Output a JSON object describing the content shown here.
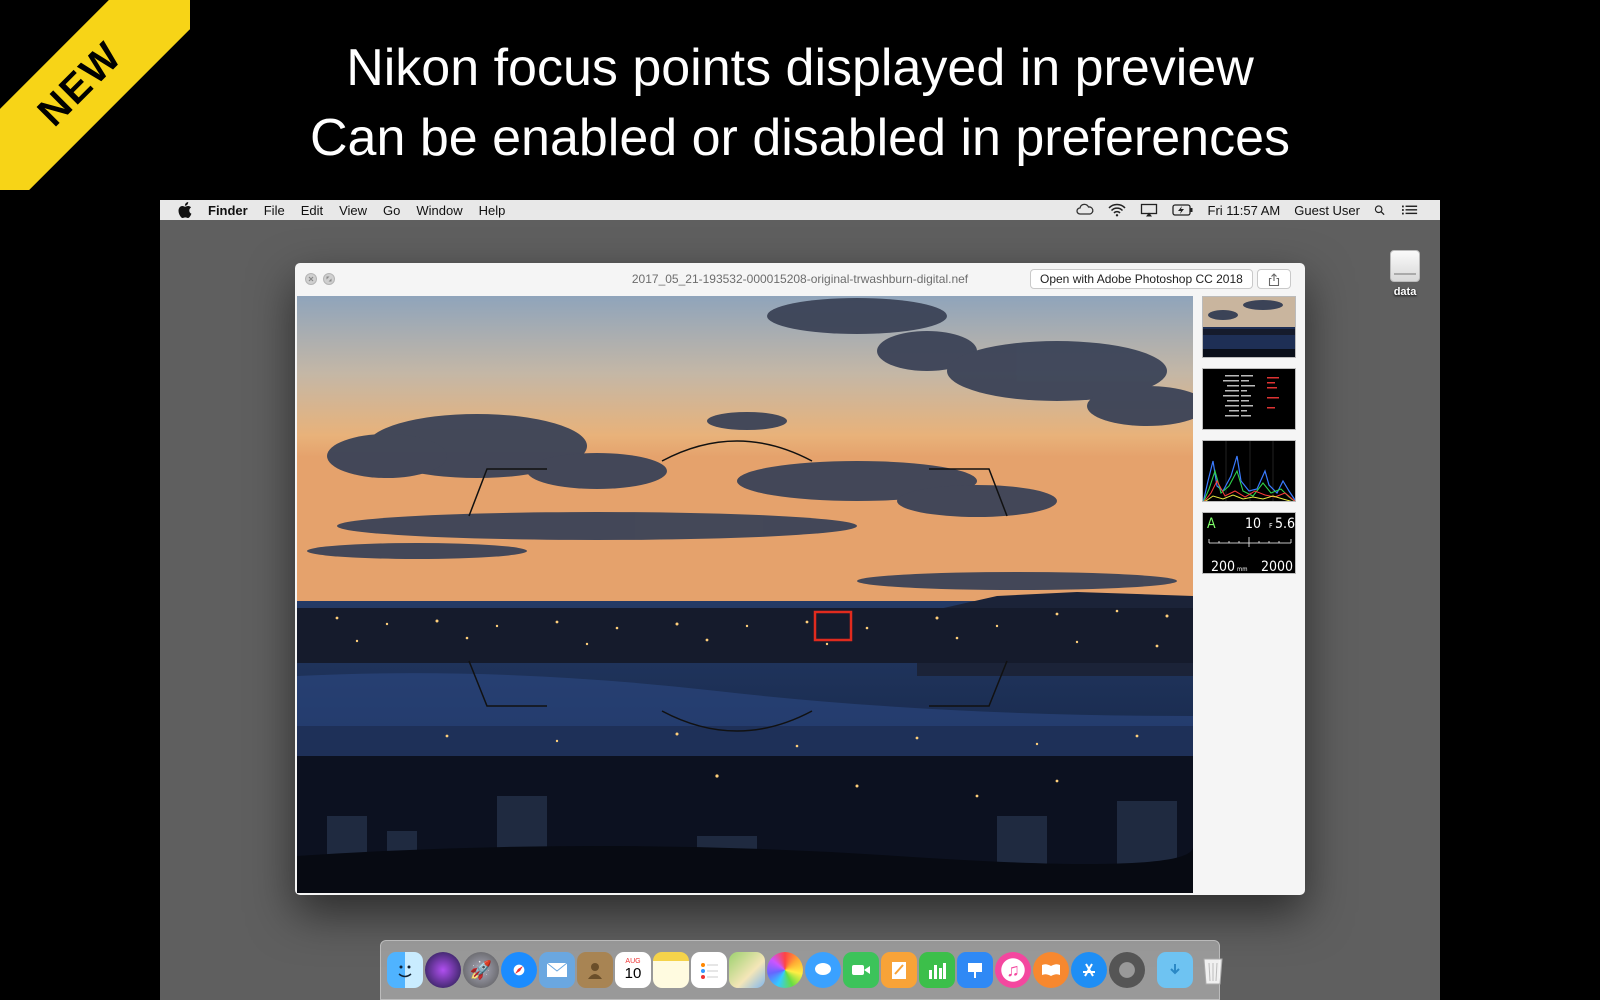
{
  "badge": {
    "label": "NEW",
    "color": "#f7d417"
  },
  "headline": {
    "line1": "Nikon focus points displayed in preview",
    "line2": "Can be enabled or disabled in preferences"
  },
  "menubar": {
    "app": "Finder",
    "items": [
      "File",
      "Edit",
      "View",
      "Go",
      "Window",
      "Help"
    ],
    "clock": "Fri 11:57 AM",
    "user": "Guest User"
  },
  "desktop": {
    "drive_label": "data"
  },
  "quicklook": {
    "filename": "2017_05_21-193532-000015208-original-trwashburn-digital.nef",
    "open_button": "Open with Adobe Photoshop CC 2018",
    "focus_point_color": "#e02b1e"
  },
  "thumbnails": {
    "exposure": {
      "mode": "A",
      "shutter": "10",
      "aperture_prefix": "F",
      "aperture": "5.6",
      "focal_length": "200",
      "focal_unit": "mm",
      "iso": "2000"
    }
  },
  "dock": {
    "icons": [
      "finder-icon",
      "siri-icon",
      "launchpad-icon",
      "safari-icon",
      "mail-icon",
      "contacts-icon",
      "calendar-icon",
      "notes-icon",
      "reminders-icon",
      "maps-icon",
      "photos-icon",
      "messages-icon",
      "facetime-icon",
      "pages-icon",
      "numbers-icon",
      "keynote-icon",
      "itunes-icon",
      "ibooks-icon",
      "app-store-icon",
      "system-preferences-icon",
      "downloads-folder-icon",
      "trash-icon"
    ],
    "calendar_month": "AUG",
    "calendar_day": "10"
  }
}
